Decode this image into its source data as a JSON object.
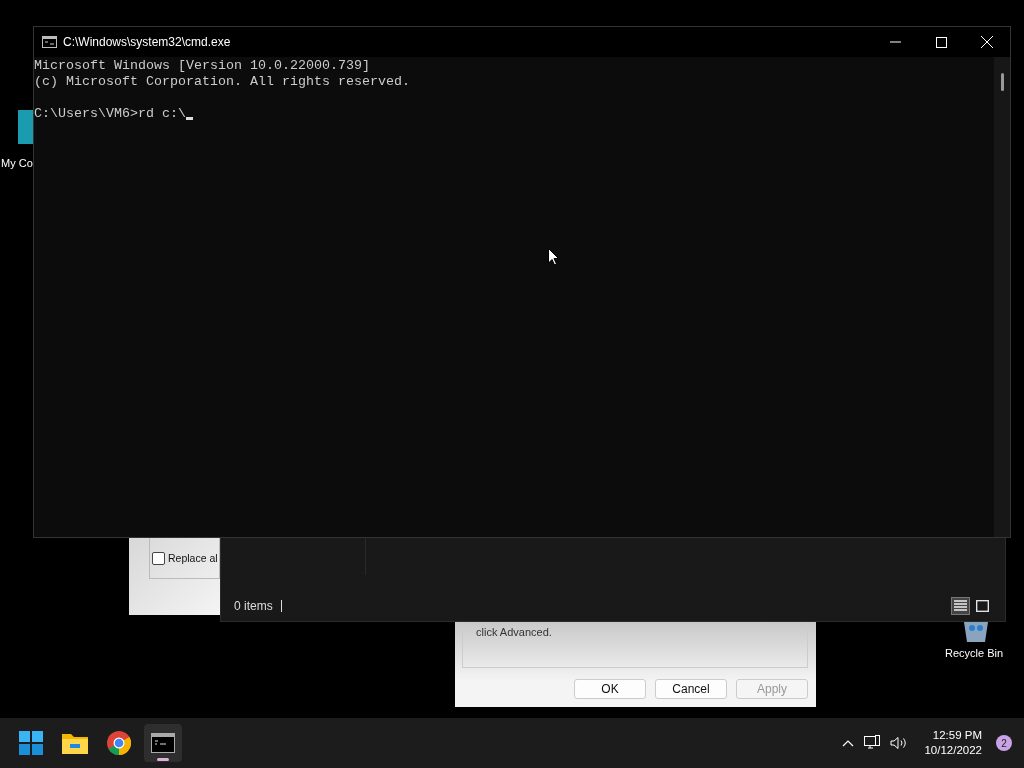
{
  "desktop_icons": [
    {
      "kind": "computer",
      "label": "My Co"
    },
    {
      "kind": "bin",
      "label": "Recycle Bin"
    }
  ],
  "back_dialog": {
    "checkbox": {
      "label": "Replace al",
      "checked": false
    }
  },
  "explorer": {
    "status": "0 items",
    "views": [
      {
        "kind": "details",
        "selected": true
      },
      {
        "kind": "tiles",
        "selected": false
      }
    ]
  },
  "properties": {
    "text": "click Advanced.",
    "buttons": [
      {
        "label": "OK",
        "disabled": false
      },
      {
        "label": "Cancel",
        "disabled": false
      },
      {
        "label": "Apply",
        "disabled": true
      }
    ]
  },
  "console": {
    "title": "C:\\Windows\\system32\\cmd.exe",
    "banner": [
      "Microsoft Windows [Version 10.0.22000.739]",
      "(c) Microsoft Corporation. All rights reserved."
    ],
    "prompt": "C:\\Users\\VM6>rd c:\\"
  },
  "taskbar": {
    "apps": [
      {
        "kind": "start",
        "selected": false
      },
      {
        "kind": "folder",
        "selected": false
      },
      {
        "kind": "browser",
        "selected": false
      },
      {
        "kind": "terminal",
        "selected": true
      }
    ],
    "time": "12:59 PM",
    "date": "10/12/2022",
    "notifications": "2"
  }
}
